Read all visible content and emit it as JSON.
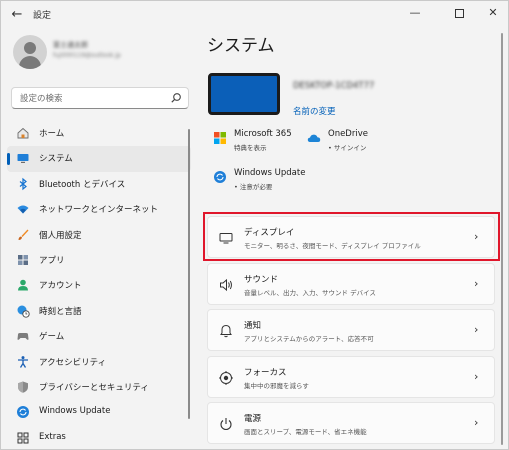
{
  "window": {
    "title": "設定"
  },
  "user": {
    "name": "富士通太郎",
    "email": "fuji000119@outlook.jp"
  },
  "search": {
    "placeholder": "設定の検索"
  },
  "sidebar": {
    "items": [
      {
        "label": "ホーム",
        "icon": "home-icon"
      },
      {
        "label": "システム",
        "icon": "monitor-icon",
        "active": true
      },
      {
        "label": "Bluetooth とデバイス",
        "icon": "bluetooth-icon"
      },
      {
        "label": "ネットワークとインターネット",
        "icon": "wifi-icon"
      },
      {
        "label": "個人用設定",
        "icon": "brush-icon"
      },
      {
        "label": "アプリ",
        "icon": "apps-icon"
      },
      {
        "label": "アカウント",
        "icon": "account-icon"
      },
      {
        "label": "時刻と言語",
        "icon": "globe-clock-icon"
      },
      {
        "label": "ゲーム",
        "icon": "gamepad-icon"
      },
      {
        "label": "アクセシビリティ",
        "icon": "accessibility-icon"
      },
      {
        "label": "プライバシーとセキュリティ",
        "icon": "shield-icon"
      },
      {
        "label": "Windows Update",
        "icon": "update-icon"
      },
      {
        "label": "Extras",
        "icon": "extras-icon"
      }
    ]
  },
  "main": {
    "title": "システム",
    "device_name": "DESKTOP-1CD4T77",
    "rename_link": "名前の変更",
    "tiles": [
      {
        "title": "Microsoft 365",
        "subtitle": "特典を表示",
        "icon": "microsoft365-icon"
      },
      {
        "title": "OneDrive",
        "subtitle": "• サインイン",
        "icon": "onedrive-icon"
      },
      {
        "title": "Windows Update",
        "subtitle": "• 注意が必要",
        "icon": "windows-update-icon"
      }
    ],
    "cards": [
      {
        "title": "ディスプレイ",
        "desc": "モニター、明るさ、夜間モード、ディスプレイ プロファイル",
        "icon": "display-icon",
        "highlighted": true
      },
      {
        "title": "サウンド",
        "desc": "音量レベル、出力、入力、サウンド デバイス",
        "icon": "speaker-icon"
      },
      {
        "title": "通知",
        "desc": "アプリとシステムからのアラート、応答不可",
        "icon": "bell-icon"
      },
      {
        "title": "フォーカス",
        "desc": "集中中の邪魔を減らす",
        "icon": "focus-icon"
      },
      {
        "title": "電源",
        "desc": "画面とスリープ、電源モード、省エネ機能",
        "icon": "power-icon"
      }
    ]
  },
  "colors": {
    "accent": "#005fb8",
    "highlight": "#e0162b",
    "device": "#0b5fb8"
  }
}
